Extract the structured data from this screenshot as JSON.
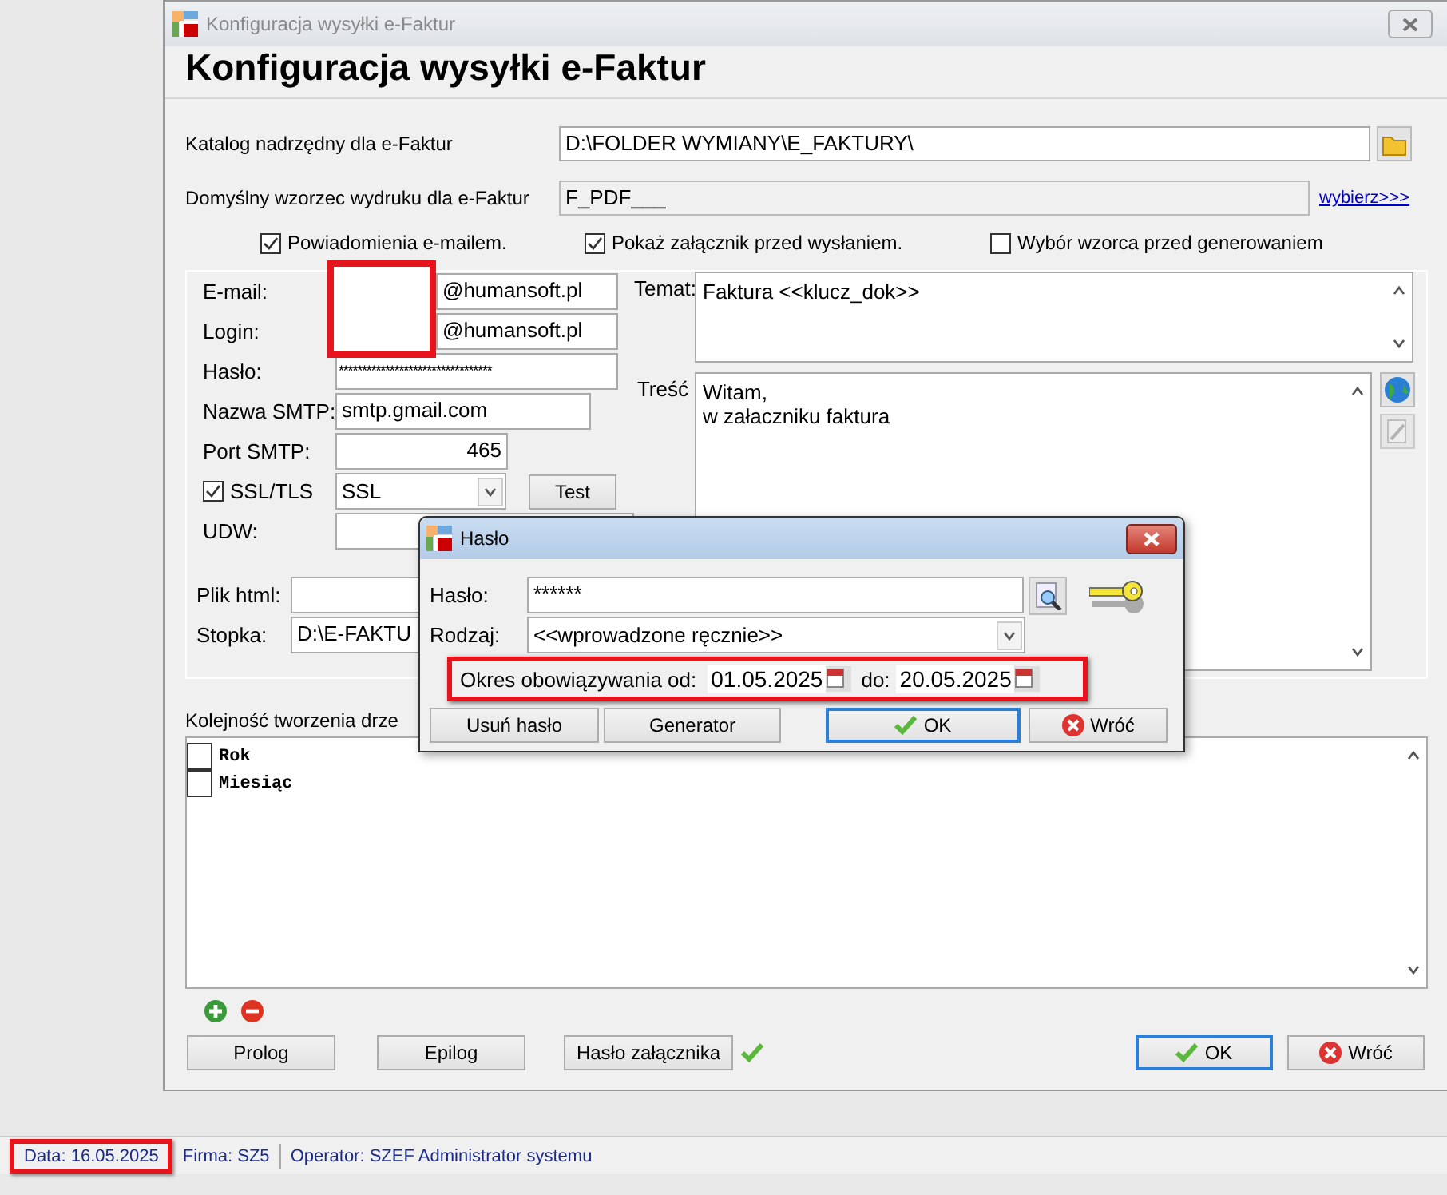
{
  "window": {
    "title": "Konfiguracja wysyłki e-Faktur",
    "heading": "Konfiguracja wysyłki e-Faktur"
  },
  "folder": {
    "label": "Katalog nadrzędny dla e-Faktur",
    "value": "D:\\FOLDER WYMIANY\\E_FAKTURY\\"
  },
  "template": {
    "label": "Domyślny wzorzec wydruku dla e-Faktur",
    "value": "F_PDF___",
    "link": "wybierz>>>"
  },
  "options": [
    {
      "label": "Powiadomienia e-mailem.",
      "checked": true
    },
    {
      "label": "Pokaż załącznik przed wysłaniem.",
      "checked": true
    },
    {
      "label": "Wybór wzorca przed generowaniem",
      "checked": false
    }
  ],
  "account": [
    {
      "kind": "text",
      "label": "E-mail:",
      "value": "@humansoft.pl",
      "redacted": true
    },
    {
      "kind": "text",
      "label": "Login:",
      "value": "@humansoft.pl",
      "redacted": true
    },
    {
      "kind": "password",
      "label": "Hasło:",
      "value": "*********************************"
    },
    {
      "kind": "text",
      "label": "Nazwa SMTP:",
      "value": "smtp.gmail.com"
    },
    {
      "kind": "number",
      "label": "Port SMTP:",
      "value": "465"
    },
    {
      "kind": "ssl",
      "label": "SSL/TLS",
      "checked": true,
      "value": "SSL",
      "button": "Test"
    },
    {
      "kind": "text",
      "label": "UDW:"
    }
  ],
  "files": [
    {
      "label": "Plik html:"
    },
    {
      "label": "Stopka:",
      "value": "D:\\E-FAKTU"
    }
  ],
  "subject": {
    "label": "Temat:",
    "value": "Faktura <<klucz_dok>>"
  },
  "message": {
    "label": "Treść",
    "lines": [
      "Witam,",
      "w załaczniku faktura"
    ]
  },
  "tree": {
    "label": "Kolejność tworzenia drze",
    "items": [
      {
        "label": "Rok",
        "checked": false
      },
      {
        "label": "Miesiąc",
        "checked": false
      }
    ]
  },
  "buttons": [
    {
      "label": "Prolog",
      "kind": "plain"
    },
    {
      "label": "Epilog",
      "kind": "plain"
    },
    {
      "label": "Hasło załącznika",
      "kind": "attachment",
      "set": true
    },
    {
      "label": "OK",
      "kind": "confirm"
    },
    {
      "label": "Wróć",
      "kind": "cancel"
    }
  ],
  "dialog": {
    "title": "Hasło",
    "password": {
      "label": "Hasło:",
      "value": "******"
    },
    "type": {
      "label": "Rodzaj:",
      "value": "<<wprowadzone ręcznie>>"
    },
    "period": {
      "label": "Okres obowiązywania od:",
      "from": "01.05.2025",
      "to_label": "do:",
      "to": "20.05.2025",
      "highlighted": true
    },
    "buttons": [
      {
        "label": "Usuń hasło",
        "kind": "plain"
      },
      {
        "label": "Generator",
        "kind": "plain"
      },
      {
        "label": "OK",
        "kind": "confirm"
      },
      {
        "label": "Wróć",
        "kind": "cancel"
      }
    ]
  },
  "status_bar": [
    {
      "text": "Data: 16.05.2025",
      "highlighted": true
    },
    {
      "text": "Firma: SZ5",
      "highlighted": false
    },
    {
      "text": "Operator: SZEF Administrator systemu",
      "highlighted": false
    }
  ]
}
